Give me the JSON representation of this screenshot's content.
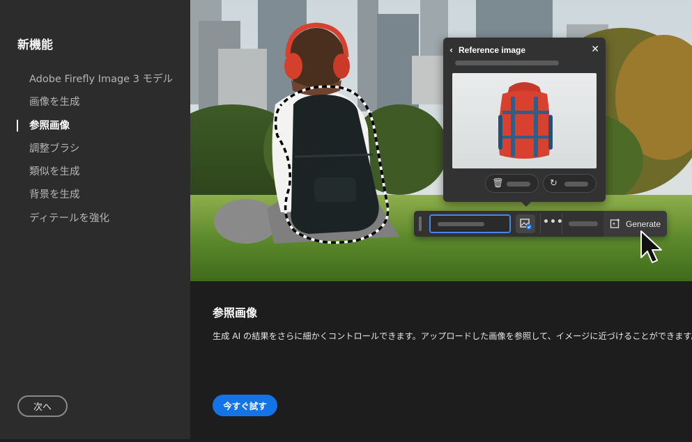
{
  "sidebar": {
    "title": "新機能",
    "items": [
      {
        "label": "Adobe Firefly Image 3 モデル",
        "active": false
      },
      {
        "label": "画像を生成",
        "active": false
      },
      {
        "label": "参照画像",
        "active": true
      },
      {
        "label": "調整ブラシ",
        "active": false
      },
      {
        "label": "類似を生成",
        "active": false
      },
      {
        "label": "背景を生成",
        "active": false
      },
      {
        "label": "ディテールを強化",
        "active": false
      }
    ],
    "next_label": "次へ"
  },
  "popover": {
    "back_icon": "chevron-left-icon",
    "title": "Reference image",
    "close_icon": "close-icon",
    "delete_icon": "trash-icon",
    "refresh_icon": "refresh-icon"
  },
  "toolbar": {
    "generate_label": "Generate",
    "more_icon": "more-icon",
    "reference_icon": "reference-image-icon",
    "generate_icon": "generate-icon"
  },
  "content": {
    "title": "参照画像",
    "description": "生成 AI の結果をさらに細かくコントロールできます。アップロードした画像を参照して、イメージに近づけることができます。",
    "cta_label": "今すぐ試す"
  },
  "colors": {
    "accent": "#1473e6",
    "sidebar_bg": "#2c2c2c",
    "content_bg": "#1d1d1d",
    "input_border": "#4b86e6"
  }
}
